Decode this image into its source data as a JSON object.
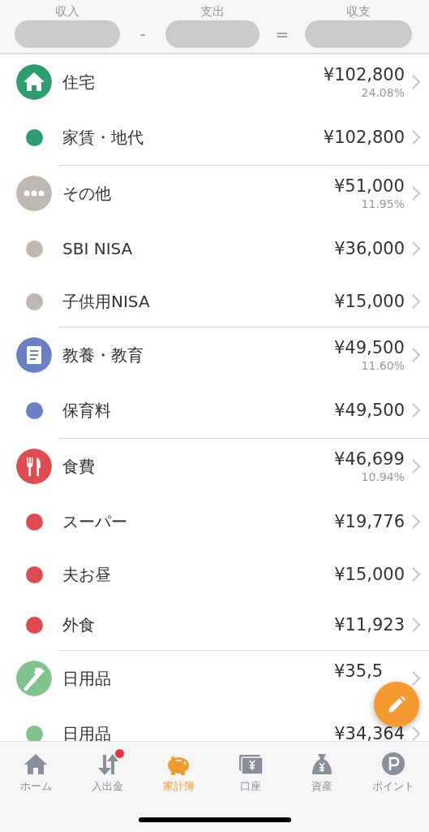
{
  "summary": {
    "labels": [
      "収入",
      "支出",
      "収支"
    ],
    "operators": [
      "-",
      "="
    ]
  },
  "groups": [
    {
      "name": "住宅",
      "color": "#2e9e70",
      "amount": "¥102,800",
      "percent": "24.08%",
      "items": [
        {
          "name": "家賃・地代",
          "amount": "¥102,800"
        }
      ]
    },
    {
      "name": "その他",
      "color": "#bdb8b1",
      "amount": "¥51,000",
      "percent": "11.95%",
      "items": [
        {
          "name": "SBI NISA",
          "amount": "¥36,000"
        },
        {
          "name": "子供用NISA",
          "amount": "¥15,000"
        }
      ]
    },
    {
      "name": "教養・教育",
      "color": "#6b7fc4",
      "amount": "¥49,500",
      "percent": "11.60%",
      "items": [
        {
          "name": "保育料",
          "amount": "¥49,500"
        }
      ]
    },
    {
      "name": "食費",
      "color": "#de4c52",
      "amount": "¥46,699",
      "percent": "10.94%",
      "items": [
        {
          "name": "スーパー",
          "amount": "¥19,776"
        },
        {
          "name": "夫お昼",
          "amount": "¥15,000"
        },
        {
          "name": "外食",
          "amount": "¥11,923"
        }
      ]
    },
    {
      "name": "日用品",
      "color": "#7ec48c",
      "amount": "¥35,5",
      "items": [
        {
          "name": "日用品",
          "amount": "¥34,364"
        }
      ]
    }
  ],
  "tabs": [
    {
      "label": "ホーム",
      "selected": false,
      "badge": false
    },
    {
      "label": "入出金",
      "selected": false,
      "badge": true
    },
    {
      "label": "家計簿",
      "selected": true,
      "badge": false
    },
    {
      "label": "口座",
      "selected": false,
      "badge": false
    },
    {
      "label": "資産",
      "selected": false,
      "badge": false
    },
    {
      "label": "ポイント",
      "selected": false,
      "badge": false
    }
  ]
}
